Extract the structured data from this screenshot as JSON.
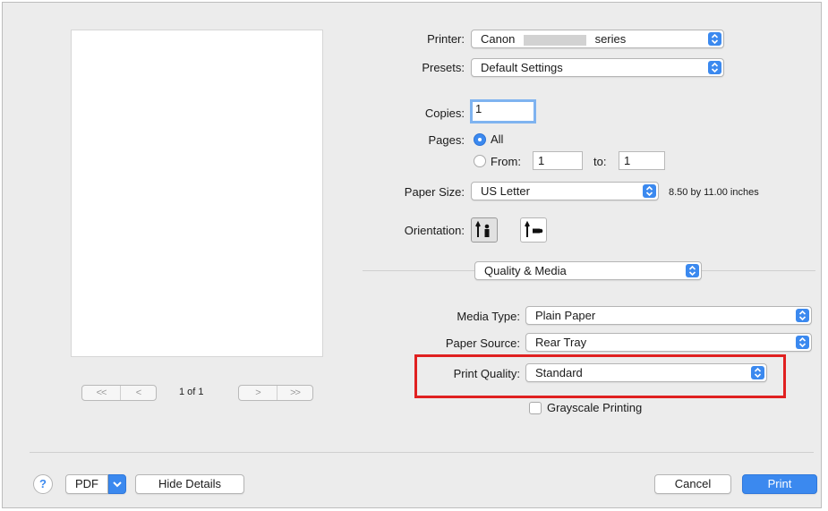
{
  "preview": {
    "page_count": "1 of 1",
    "nav_first": "<<",
    "nav_prev": "<",
    "nav_next": ">",
    "nav_last": ">>"
  },
  "printer": {
    "label": "Printer:",
    "value_prefix": "Canon",
    "value_suffix": "series"
  },
  "presets": {
    "label": "Presets:",
    "value": "Default Settings"
  },
  "copies": {
    "label": "Copies:",
    "value": "1"
  },
  "pages": {
    "label": "Pages:",
    "all_label": "All",
    "from_label": "From:",
    "from_value": "1",
    "to_label": "to:",
    "to_value": "1",
    "selected": "All"
  },
  "paper_size": {
    "label": "Paper Size:",
    "value": "US Letter",
    "dimensions": "8.50 by 11.00 inches"
  },
  "orientation": {
    "label": "Orientation:",
    "selected": "portrait"
  },
  "section": {
    "value": "Quality & Media"
  },
  "media_type": {
    "label": "Media Type:",
    "value": "Plain Paper"
  },
  "paper_source": {
    "label": "Paper Source:",
    "value": "Rear Tray"
  },
  "print_quality": {
    "label": "Print Quality:",
    "value": "Standard"
  },
  "grayscale": {
    "label": "Grayscale Printing",
    "checked": false
  },
  "footer": {
    "help": "?",
    "pdf": "PDF",
    "hide_details": "Hide Details",
    "cancel": "Cancel",
    "print": "Print"
  },
  "colors": {
    "accent": "#3b89ef",
    "highlight": "#e02020",
    "dialog_bg": "#ececec"
  },
  "icons": {
    "popup_arrows": "up-down-chevron-icon",
    "pdf_menu": "chevron-down-icon",
    "portrait": "portrait-orientation-icon",
    "landscape": "landscape-orientation-icon"
  }
}
